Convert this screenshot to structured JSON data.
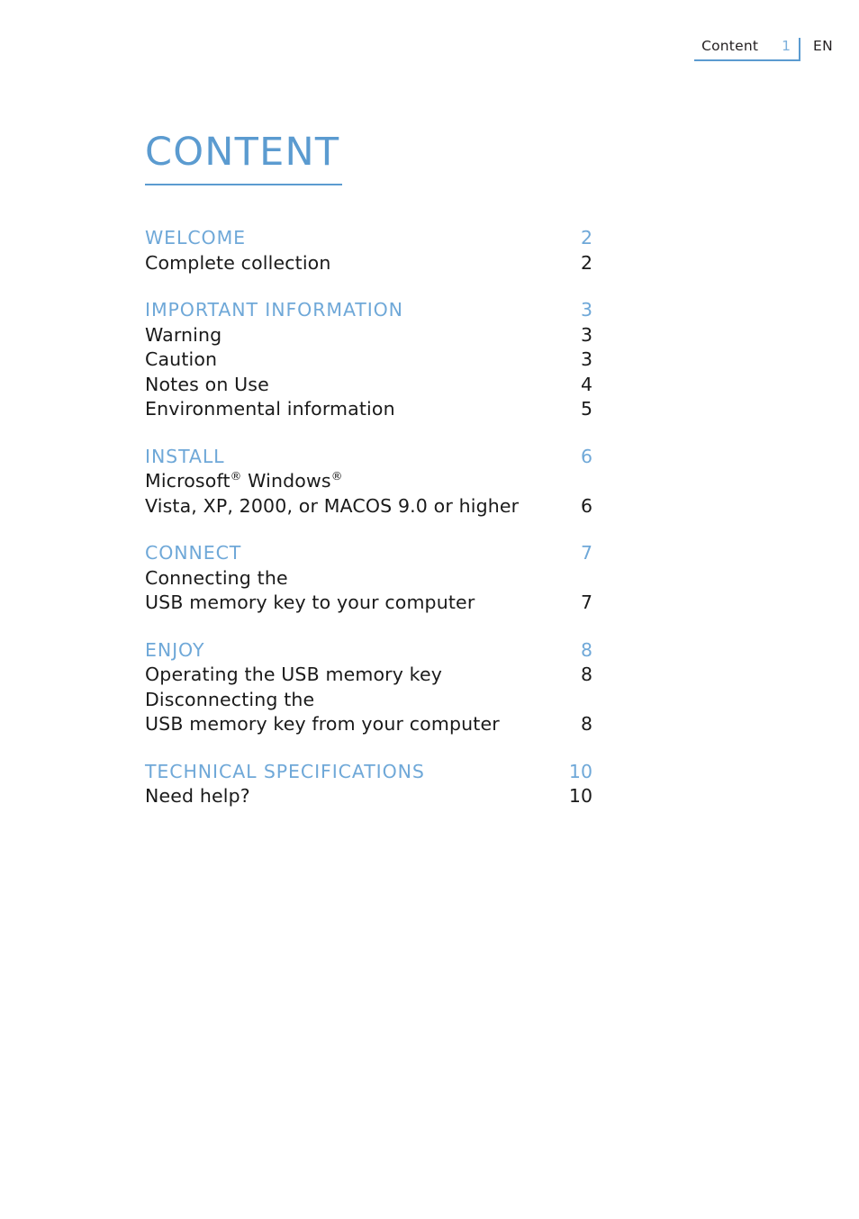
{
  "header": {
    "label": "Content",
    "page_number": "1",
    "language": "EN"
  },
  "title": "CONTENT",
  "toc": {
    "sections": [
      {
        "heading": "WELCOME",
        "heading_page": "2",
        "entries": [
          {
            "lines": [
              "Complete collection"
            ],
            "page": "2"
          }
        ]
      },
      {
        "heading": "IMPORTANT INFORMATION",
        "heading_page": "3",
        "entries": [
          {
            "lines": [
              "Warning"
            ],
            "page": "3"
          },
          {
            "lines": [
              "Caution"
            ],
            "page": "3"
          },
          {
            "lines": [
              "Notes on Use"
            ],
            "page": "4"
          },
          {
            "lines": [
              "Environmental information"
            ],
            "page": "5"
          }
        ]
      },
      {
        "heading": "INSTALL",
        "heading_page": "6",
        "entries": [
          {
            "lines": [
              "Microsoft® Windows®",
              "Vista, XP, 2000, or MACOS 9.0 or higher"
            ],
            "page": "6"
          }
        ]
      },
      {
        "heading": "CONNECT",
        "heading_page": "7",
        "entries": [
          {
            "lines": [
              "Connecting the",
              "USB memory key to your computer"
            ],
            "page": "7"
          }
        ]
      },
      {
        "heading": "ENJOY",
        "heading_page": "8",
        "entries": [
          {
            "lines": [
              "Operating the USB memory key"
            ],
            "page": "8"
          },
          {
            "lines": [
              "Disconnecting the",
              "USB memory key from your computer"
            ],
            "page": "8"
          }
        ]
      },
      {
        "heading": "TECHNICAL SPECIFICATIONS",
        "heading_page": "10",
        "entries": [
          {
            "lines": [
              "Need help?"
            ],
            "page": "10"
          }
        ]
      }
    ]
  },
  "colors": {
    "accent_blue": "#5b9bd0",
    "heading_blue": "#6fa8d8",
    "header_page_blue": "#7db0dc",
    "body_text": "#1a1a1a"
  }
}
